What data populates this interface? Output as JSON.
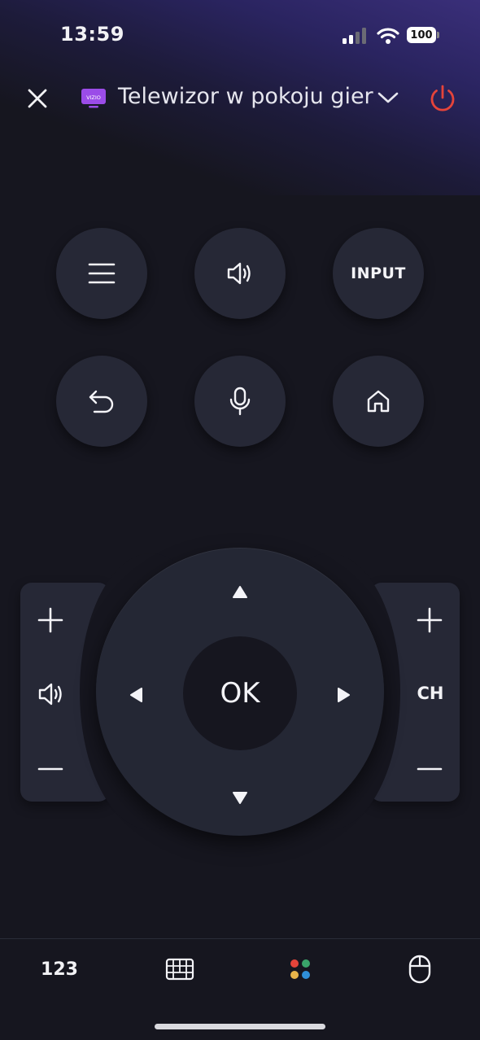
{
  "status_bar": {
    "time": "13:59",
    "battery": "100"
  },
  "header": {
    "device_name": "Telewizor w pokoju gier",
    "device_icon": "tv-icon",
    "power_color": "#e5443a",
    "device_icon_color": "#9b4ce8"
  },
  "buttons": {
    "menu": "menu-icon",
    "sound": "speaker-icon",
    "input_label": "INPUT",
    "back": "back-icon",
    "voice": "microphone-icon",
    "home": "home-icon"
  },
  "dpad": {
    "ok_label": "OK"
  },
  "channel": {
    "label": "CH"
  },
  "volume": {
    "icon": "speaker-icon"
  },
  "bottom_tabs": {
    "numbers_label": "123",
    "keyboard": "keyboard-icon",
    "colors": "color-dots-icon",
    "mouse": "mouse-icon",
    "dot_colors": [
      "#e5443a",
      "#3aa56a",
      "#e8b44a",
      "#2f8fd8"
    ]
  }
}
